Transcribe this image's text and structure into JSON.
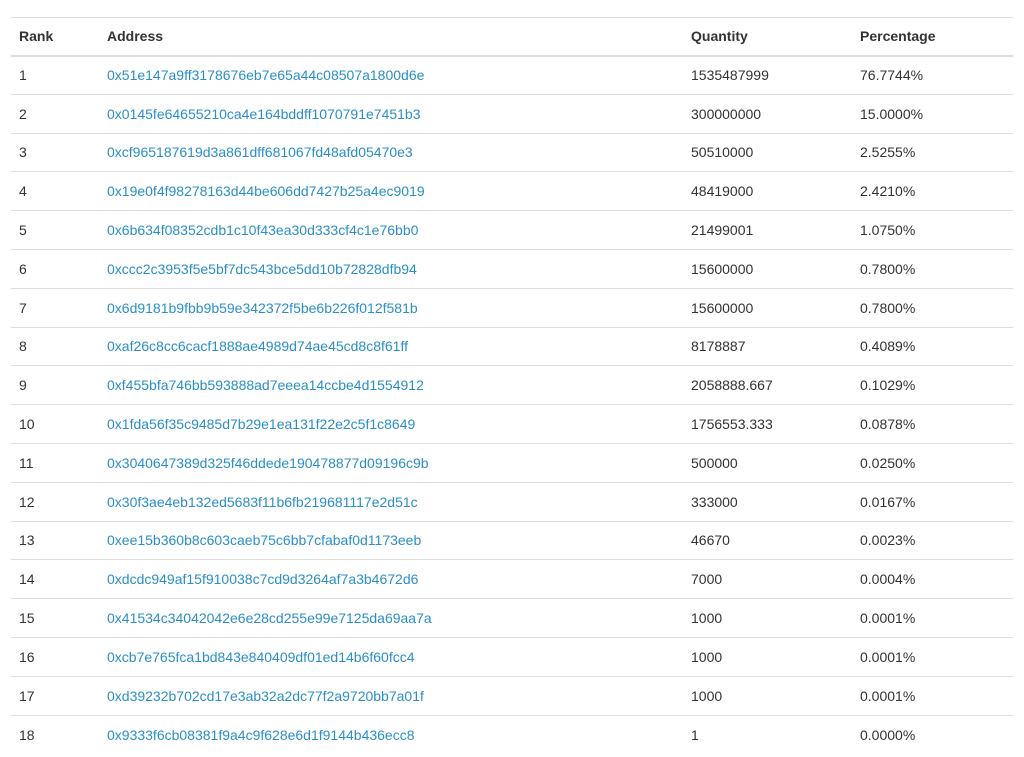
{
  "table": {
    "headers": {
      "rank": "Rank",
      "address": "Address",
      "quantity": "Quantity",
      "percentage": "Percentage"
    },
    "rows": [
      {
        "rank": "1",
        "address": "0x51e147a9ff3178676eb7e65a44c08507a1800d6e",
        "quantity": "1535487999",
        "percentage": "76.7744%"
      },
      {
        "rank": "2",
        "address": "0x0145fe64655210ca4e164bddff1070791e7451b3",
        "quantity": "300000000",
        "percentage": "15.0000%"
      },
      {
        "rank": "3",
        "address": "0xcf965187619d3a861dff681067fd48afd05470e3",
        "quantity": "50510000",
        "percentage": "2.5255%"
      },
      {
        "rank": "4",
        "address": "0x19e0f4f98278163d44be606dd7427b25a4ec9019",
        "quantity": "48419000",
        "percentage": "2.4210%"
      },
      {
        "rank": "5",
        "address": "0x6b634f08352cdb1c10f43ea30d333cf4c1e76bb0",
        "quantity": "21499001",
        "percentage": "1.0750%"
      },
      {
        "rank": "6",
        "address": "0xccc2c3953f5e5bf7dc543bce5dd10b72828dfb94",
        "quantity": "15600000",
        "percentage": "0.7800%"
      },
      {
        "rank": "7",
        "address": "0x6d9181b9fbb9b59e342372f5be6b226f012f581b",
        "quantity": "15600000",
        "percentage": "0.7800%"
      },
      {
        "rank": "8",
        "address": "0xaf26c8cc6cacf1888ae4989d74ae45cd8c8f61ff",
        "quantity": "8178887",
        "percentage": "0.4089%"
      },
      {
        "rank": "9",
        "address": "0xf455bfa746bb593888ad7eeea14ccbe4d1554912",
        "quantity": "2058888.667",
        "percentage": "0.1029%"
      },
      {
        "rank": "10",
        "address": "0x1fda56f35c9485d7b29e1ea131f22e2c5f1c8649",
        "quantity": "1756553.333",
        "percentage": "0.0878%"
      },
      {
        "rank": "11",
        "address": "0x3040647389d325f46ddede190478877d09196c9b",
        "quantity": "500000",
        "percentage": "0.0250%"
      },
      {
        "rank": "12",
        "address": "0x30f3ae4eb132ed5683f11b6fb219681117e2d51c",
        "quantity": "333000",
        "percentage": "0.0167%"
      },
      {
        "rank": "13",
        "address": "0xee15b360b8c603caeb75c6bb7cfabaf0d1173eeb",
        "quantity": "46670",
        "percentage": "0.0023%"
      },
      {
        "rank": "14",
        "address": "0xdcdc949af15f910038c7cd9d3264af7a3b4672d6",
        "quantity": "7000",
        "percentage": "0.0004%"
      },
      {
        "rank": "15",
        "address": "0x41534c34042042e6e28cd255e99e7125da69aa7a",
        "quantity": "1000",
        "percentage": "0.0001%"
      },
      {
        "rank": "16",
        "address": "0xcb7e765fca1bd843e840409df01ed14b6f60fcc4",
        "quantity": "1000",
        "percentage": "0.0001%"
      },
      {
        "rank": "17",
        "address": "0xd39232b702cd17e3ab32a2dc77f2a9720bb7a01f",
        "quantity": "1000",
        "percentage": "0.0001%"
      },
      {
        "rank": "18",
        "address": "0x9333f6cb08381f9a4c9f628e6d1f9144b436ecc8",
        "quantity": "1",
        "percentage": "0.0000%"
      }
    ]
  },
  "colors": {
    "link": "#2a8fc9",
    "text": "#333333",
    "border": "#dddddd"
  }
}
